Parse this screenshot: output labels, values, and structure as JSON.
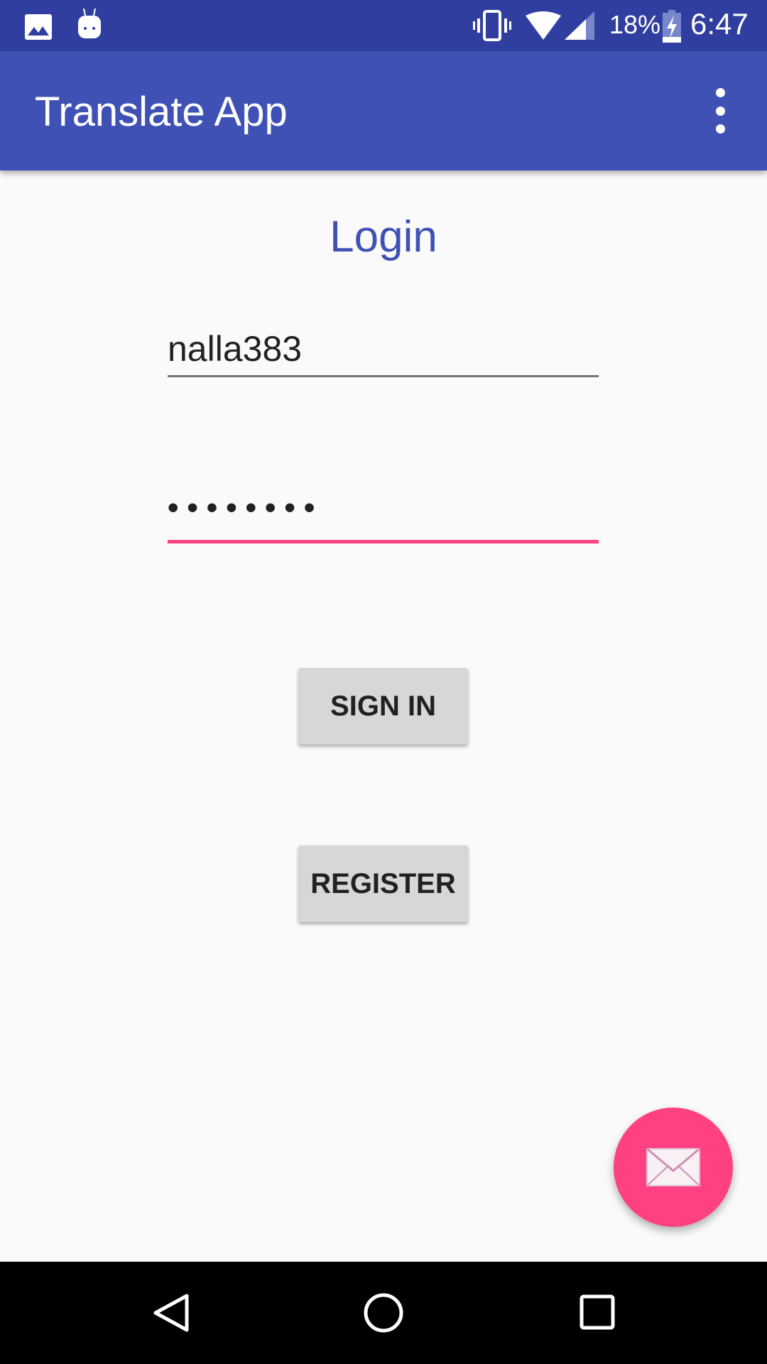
{
  "status_bar": {
    "battery": "18%",
    "time": "6:47"
  },
  "app_bar": {
    "title": "Translate App"
  },
  "login": {
    "heading": "Login",
    "username": "nalla383",
    "password": "••••••••",
    "sign_in": "SIGN IN",
    "register": "REGISTER"
  },
  "colors": {
    "primary": "#3f51b5",
    "primary_dark": "#303f9f",
    "accent": "#ff4081"
  }
}
